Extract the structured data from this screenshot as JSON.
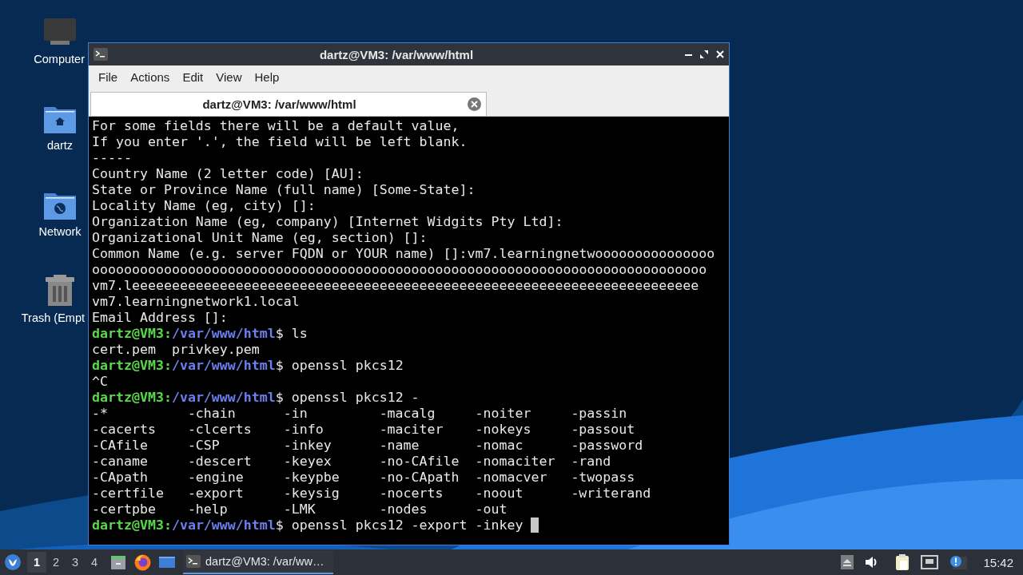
{
  "desktop_icons": [
    {
      "label": "Computer",
      "kind": "computer"
    },
    {
      "label": "dartz",
      "kind": "home"
    },
    {
      "label": "Network",
      "kind": "network"
    },
    {
      "label": "Trash (Empt",
      "kind": "trash"
    }
  ],
  "window": {
    "title": "dartz@VM3: /var/www/html",
    "menu": [
      "File",
      "Actions",
      "Edit",
      "View",
      "Help"
    ],
    "tabs": [
      {
        "label": "dartz@VM3: /var/www/html",
        "selected": true
      }
    ]
  },
  "terminal": {
    "lines": [
      {
        "kind": "text",
        "text": "For some fields there will be a default value,"
      },
      {
        "kind": "text",
        "text": "If you enter '.', the field will be left blank."
      },
      {
        "kind": "text",
        "text": "-----"
      },
      {
        "kind": "text",
        "text": "Country Name (2 letter code) [AU]:"
      },
      {
        "kind": "text",
        "text": "State or Province Name (full name) [Some-State]:"
      },
      {
        "kind": "text",
        "text": "Locality Name (eg, city) []:"
      },
      {
        "kind": "text",
        "text": "Organization Name (eg, company) [Internet Widgits Pty Ltd]:"
      },
      {
        "kind": "text",
        "text": "Organizational Unit Name (eg, section) []:"
      },
      {
        "kind": "text",
        "text": "Common Name (e.g. server FQDN or YOUR name) []:vm7.learningnetwooooooooooooooo"
      },
      {
        "kind": "text",
        "text": "ooooooooooooooooooooooooooooooooooooooooooooooooooooooooooooooooooooooooooooo"
      },
      {
        "kind": "text",
        "text": "vm7.leeeeeeeeeeeeeeeeeeeeeeeeeeeeeeeeeeeeeeeeeeeeeeeeeeeeeeeeeeeeeeeeeeeeeee"
      },
      {
        "kind": "text",
        "text": "vm7.learningnetwork1.local"
      },
      {
        "kind": "text",
        "text": "Email Address []:"
      },
      {
        "kind": "prompt",
        "user": "dartz@VM3:",
        "path": "/var/www/html",
        "command": "$ ls"
      },
      {
        "kind": "text",
        "text": "cert.pem  privkey.pem"
      },
      {
        "kind": "prompt",
        "user": "dartz@VM3:",
        "path": "/var/www/html",
        "command": "$ openssl pkcs12"
      },
      {
        "kind": "text",
        "text": "^C"
      },
      {
        "kind": "prompt",
        "user": "dartz@VM3:",
        "path": "/var/www/html",
        "command": "$ openssl pkcs12 -"
      },
      {
        "kind": "columns",
        "cells": [
          "-*",
          "-chain",
          "-in",
          "-macalg",
          "-noiter",
          "-passin"
        ]
      },
      {
        "kind": "columns",
        "cells": [
          "-cacerts",
          "-clcerts",
          "-info",
          "-maciter",
          "-nokeys",
          "-passout"
        ]
      },
      {
        "kind": "columns",
        "cells": [
          "-CAfile",
          "-CSP",
          "-inkey",
          "-name",
          "-nomac",
          "-password"
        ]
      },
      {
        "kind": "columns",
        "cells": [
          "-caname",
          "-descert",
          "-keyex",
          "-no-CAfile",
          "-nomaciter",
          "-rand"
        ]
      },
      {
        "kind": "columns",
        "cells": [
          "-CApath",
          "-engine",
          "-keypbe",
          "-no-CApath",
          "-nomacver",
          "-twopass"
        ]
      },
      {
        "kind": "columns",
        "cells": [
          "-certfile",
          "-export",
          "-keysig",
          "-nocerts",
          "-noout",
          "-writerand"
        ]
      },
      {
        "kind": "columns",
        "cells": [
          "-certpbe",
          "-help",
          "-LMK",
          "-nodes",
          "-out"
        ]
      },
      {
        "kind": "prompt",
        "user": "dartz@VM3:",
        "path": "/var/www/html",
        "command": "$ openssl pkcs12 -export -inkey",
        "cursor": true
      }
    ]
  },
  "taskbar": {
    "workspaces": [
      {
        "label": "1",
        "selected": true
      },
      {
        "label": "2",
        "selected": false
      },
      {
        "label": "3",
        "selected": false
      },
      {
        "label": "4",
        "selected": false
      }
    ],
    "tasks": [
      {
        "label": "dartz@VM3: /var/ww…",
        "selected": true
      }
    ],
    "clock": "15:42"
  }
}
